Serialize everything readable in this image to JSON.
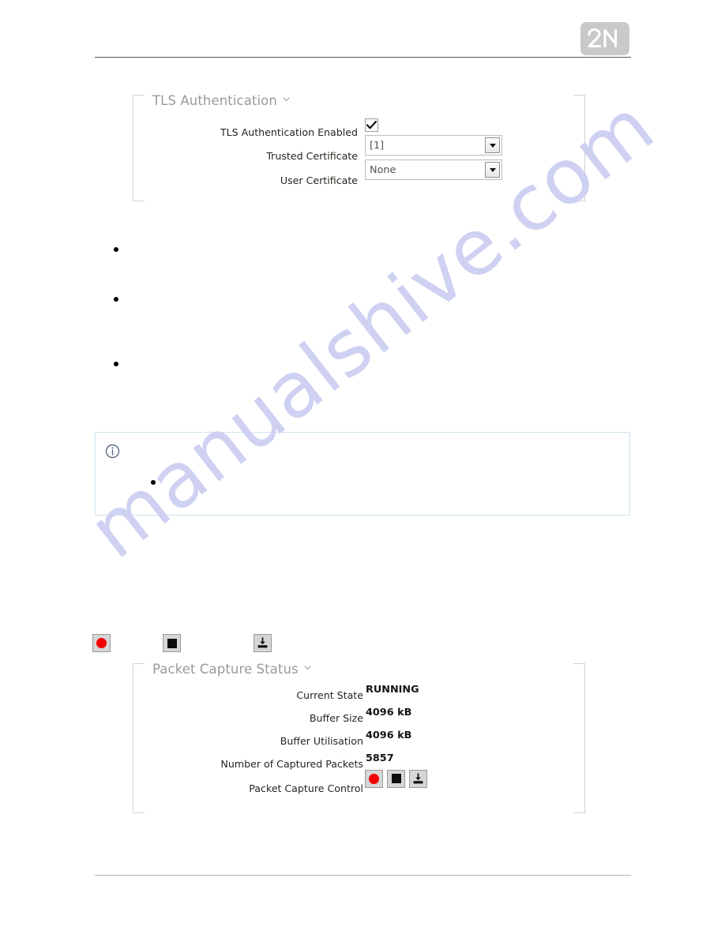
{
  "header": {
    "logo_alt": "2N",
    "logo_color": "#c9c9c9"
  },
  "watermark": {
    "text": "manualshive.com",
    "color": "#cdcff2"
  },
  "tls_panel": {
    "title": "TLS Authentication",
    "chevron": "chevron-down-icon",
    "rows": [
      {
        "label": "TLS Authentication Enabled",
        "type": "checkbox",
        "value": "checked"
      },
      {
        "label": "Trusted Certificate",
        "type": "select",
        "value": "[1]"
      },
      {
        "label": "User Certificate",
        "type": "select",
        "value": "None"
      }
    ]
  },
  "bullets": [
    {
      "text": ""
    },
    {
      "text": ""
    },
    {
      "text": ""
    }
  ],
  "info_box": {
    "icon": "info-circle-icon",
    "border_color": "#cfe4f0",
    "bullets": [
      {
        "text": ""
      }
    ]
  },
  "inline_icons": [
    {
      "name": "record-icon",
      "glyph": "red-circle"
    },
    {
      "name": "stop-icon",
      "glyph": "black-square"
    },
    {
      "name": "download-icon",
      "glyph": "download-tray"
    }
  ],
  "capture_panel": {
    "title": "Packet Capture Status",
    "chevron": "chevron-down-icon",
    "rows": [
      {
        "label": "Current State",
        "value": "RUNNING"
      },
      {
        "label": "Buffer Size",
        "value": "4096 kB"
      },
      {
        "label": "Buffer Utilisation",
        "value": "4096 kB"
      },
      {
        "label": "Number of Captured Packets",
        "value": "5857"
      }
    ],
    "control_row": {
      "label": "Packet Capture Control",
      "buttons": [
        {
          "name": "record-button",
          "glyph": "red-circle"
        },
        {
          "name": "stop-button",
          "glyph": "black-square"
        },
        {
          "name": "download-button",
          "glyph": "download-tray"
        }
      ]
    }
  }
}
